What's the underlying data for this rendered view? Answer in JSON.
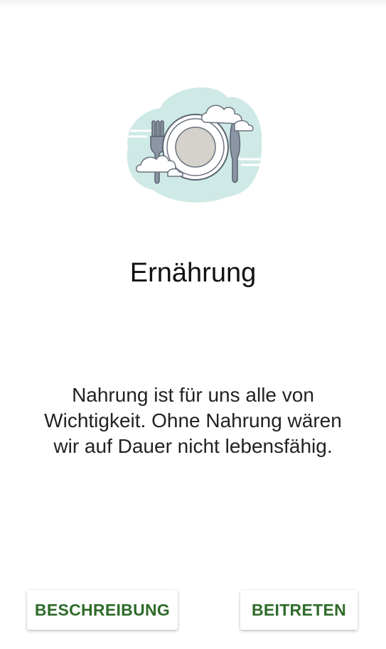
{
  "illustration": {
    "icon": "plate-fork-knife-icon"
  },
  "content": {
    "title": "Ernährung",
    "description": "Nahrung ist für uns alle von Wichtigkeit. Ohne Nahrung wären wir auf Dauer nicht lebensfähig."
  },
  "actions": {
    "description_label": "BESCHREIBUNG",
    "join_label": "BEITRETEN"
  },
  "colors": {
    "accent": "#2e6b2a",
    "blob": "#cfeae6",
    "plate_rim": "#ffffff",
    "plate_center": "#d5d2cb",
    "cutlery": "#8c95a3"
  }
}
